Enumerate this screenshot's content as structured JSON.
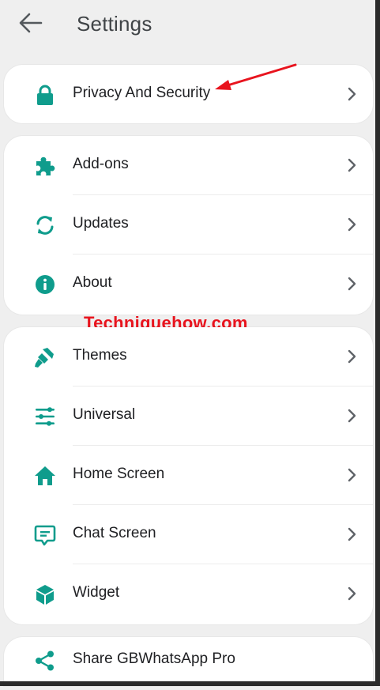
{
  "header": {
    "title": "Settings",
    "back_icon": "back-arrow-icon"
  },
  "sections": [
    {
      "items": [
        {
          "label": "Privacy And Security",
          "icon": "lock-icon"
        }
      ]
    },
    {
      "items": [
        {
          "label": "Add-ons",
          "icon": "puzzle-icon"
        },
        {
          "label": "Updates",
          "icon": "refresh-icon"
        },
        {
          "label": "About",
          "icon": "info-icon"
        }
      ]
    },
    {
      "items": [
        {
          "label": "Themes",
          "icon": "paint-brush-icon"
        },
        {
          "label": "Universal",
          "icon": "sliders-icon"
        },
        {
          "label": "Home Screen",
          "icon": "home-icon"
        },
        {
          "label": "Chat Screen",
          "icon": "chat-icon"
        },
        {
          "label": "Widget",
          "icon": "cube-icon"
        }
      ]
    },
    {
      "items": [
        {
          "label": "Share GBWhatsApp Pro",
          "icon": "share-icon"
        }
      ]
    }
  ],
  "watermark": "Techniquehow.com",
  "colors": {
    "accent": "#0f9c8c",
    "annotation": "#e8141e",
    "background": "#efefef"
  }
}
